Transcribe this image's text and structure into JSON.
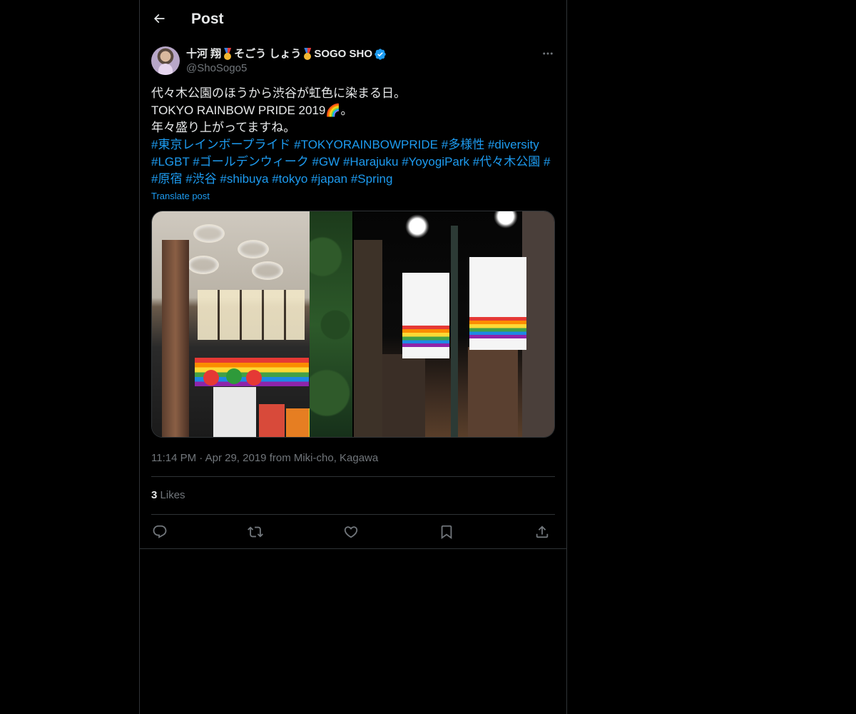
{
  "header": {
    "title": "Post"
  },
  "author": {
    "name_part1": "十河 翔",
    "name_part2": "そごう しょう",
    "name_part3": "SOGO SHO",
    "handle": "@ShoSogo5"
  },
  "post": {
    "lines": [
      "代々木公園のほうから渋谷が虹色に染まる日。",
      "TOKYO RAINBOW PRIDE 2019🌈。",
      "年々盛り上がってますね。"
    ],
    "hashtags": [
      "#東京レインボープライド",
      "#TOKYORAINBOWPRIDE",
      "#多様性",
      "#diversity",
      "#LGBT",
      "#ゴールデンウィーク",
      "#GW",
      "#Harajuku",
      "#YoyogiPark",
      "#代々木公園",
      "#原宿",
      "#渋谷",
      "#shibuya",
      "#tokyo",
      "#japan",
      "#Spring"
    ],
    "translate_label": "Translate post",
    "time": "11:14 PM",
    "separator": "·",
    "date": "Apr 29, 2019",
    "location": "from Miki-cho, Kagawa"
  },
  "stats": {
    "likes_count": "3",
    "likes_label": "Likes"
  },
  "icons": {
    "back": "arrow-left-icon",
    "more": "more-horizontal-icon",
    "reply": "reply-icon",
    "repost": "repost-icon",
    "like": "heart-icon",
    "bookmark": "bookmark-icon",
    "share": "share-icon",
    "verified": "verified-badge-icon"
  },
  "colors": {
    "background": "#000000",
    "text": "#e7e9ea",
    "secondary": "#71767b",
    "accent": "#1d9bf0",
    "border": "#2f3336"
  }
}
